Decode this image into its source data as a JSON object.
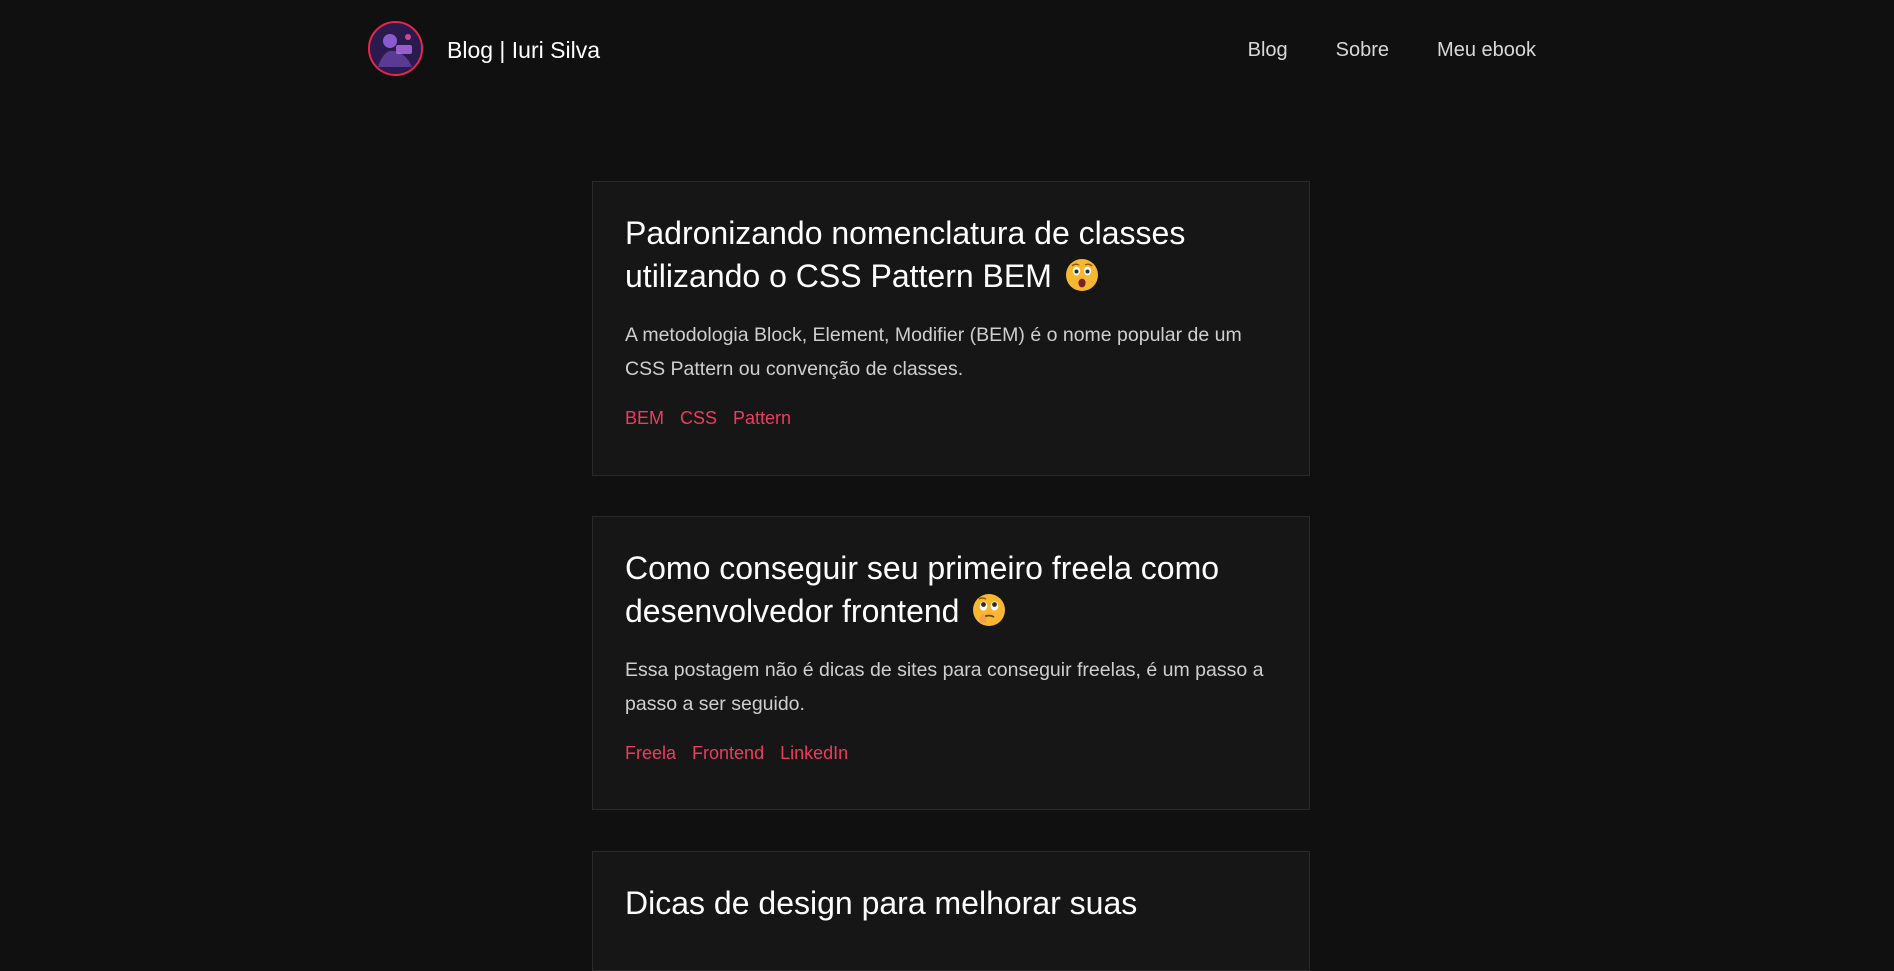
{
  "header": {
    "title": "Blog | Iuri Silva",
    "nav": [
      {
        "label": "Blog"
      },
      {
        "label": "Sobre"
      },
      {
        "label": "Meu ebook"
      }
    ]
  },
  "posts": [
    {
      "title": "Padronizando nomenclatura de classes utilizando o CSS Pattern BEM",
      "emoji": "astonished-face-icon",
      "excerpt": "A metodologia Block, Element, Modifier (BEM) é o nome popular de um CSS Pattern ou convenção de classes.",
      "tags": [
        "BEM",
        "CSS",
        "Pattern"
      ]
    },
    {
      "title": "Como conseguir seu primeiro freela como desenvolvedor frontend",
      "emoji": "face-holding-back-tears-icon",
      "excerpt": "Essa postagem não é dicas de sites para conseguir freelas, é um passo a passo a ser seguido.",
      "tags": [
        "Freela",
        "Frontend",
        "LinkedIn"
      ]
    },
    {
      "title": "Dicas de design para melhorar suas"
    }
  ],
  "colors": {
    "background": "#101010",
    "card": "#161616",
    "accent": "#f03a5f"
  }
}
